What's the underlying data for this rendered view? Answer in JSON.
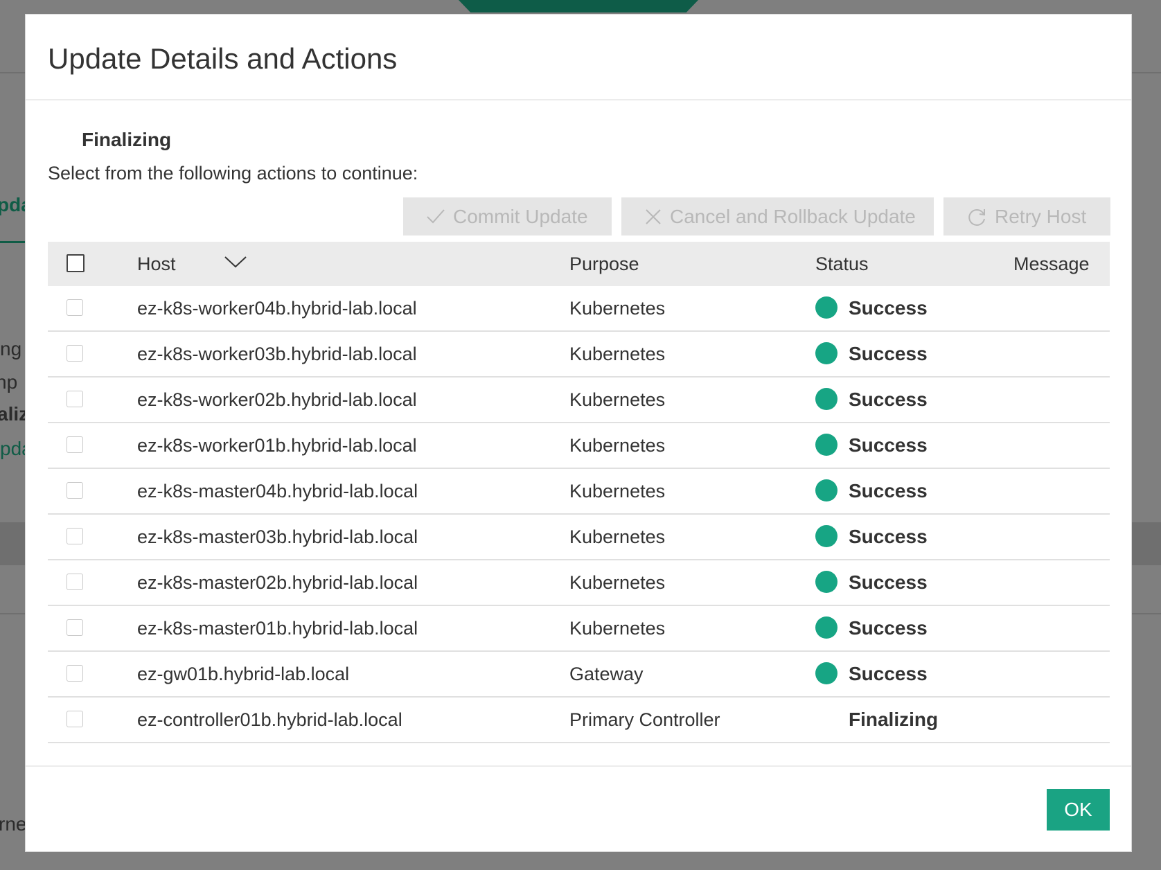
{
  "background": {
    "fragments": [
      "pda",
      "ng",
      "hp",
      "aliz",
      "pda",
      "rne"
    ]
  },
  "modal": {
    "title": "Update Details and Actions",
    "section_title": "Finalizing",
    "instructions": "Select from the following actions to continue:",
    "actions": {
      "commit_label": "Commit Update",
      "rollback_label": "Cancel and Rollback Update",
      "retry_label": "Retry Host"
    },
    "table": {
      "headers": {
        "host": "Host",
        "purpose": "Purpose",
        "status": "Status",
        "message": "Message"
      },
      "rows": [
        {
          "host": "ez-k8s-worker04b.hybrid-lab.local",
          "purpose": "Kubernetes",
          "status": "Success",
          "message": ""
        },
        {
          "host": "ez-k8s-worker03b.hybrid-lab.local",
          "purpose": "Kubernetes",
          "status": "Success",
          "message": ""
        },
        {
          "host": "ez-k8s-worker02b.hybrid-lab.local",
          "purpose": "Kubernetes",
          "status": "Success",
          "message": ""
        },
        {
          "host": "ez-k8s-worker01b.hybrid-lab.local",
          "purpose": "Kubernetes",
          "status": "Success",
          "message": ""
        },
        {
          "host": "ez-k8s-master04b.hybrid-lab.local",
          "purpose": "Kubernetes",
          "status": "Success",
          "message": ""
        },
        {
          "host": "ez-k8s-master03b.hybrid-lab.local",
          "purpose": "Kubernetes",
          "status": "Success",
          "message": ""
        },
        {
          "host": "ez-k8s-master02b.hybrid-lab.local",
          "purpose": "Kubernetes",
          "status": "Success",
          "message": ""
        },
        {
          "host": "ez-k8s-master01b.hybrid-lab.local",
          "purpose": "Kubernetes",
          "status": "Success",
          "message": ""
        },
        {
          "host": "ez-gw01b.hybrid-lab.local",
          "purpose": "Gateway",
          "status": "Success",
          "message": ""
        },
        {
          "host": "ez-controller01b.hybrid-lab.local",
          "purpose": "Primary Controller",
          "status": "Finalizing",
          "message": ""
        }
      ]
    },
    "ok_label": "OK"
  },
  "colors": {
    "accent": "#1aa383",
    "success_dot": "#17a584",
    "brand_dark": "#0e5c48"
  },
  "icons": {
    "commit": "checkmark-icon",
    "rollback": "close-icon",
    "retry": "refresh-icon",
    "sort": "chevron-down-icon"
  }
}
